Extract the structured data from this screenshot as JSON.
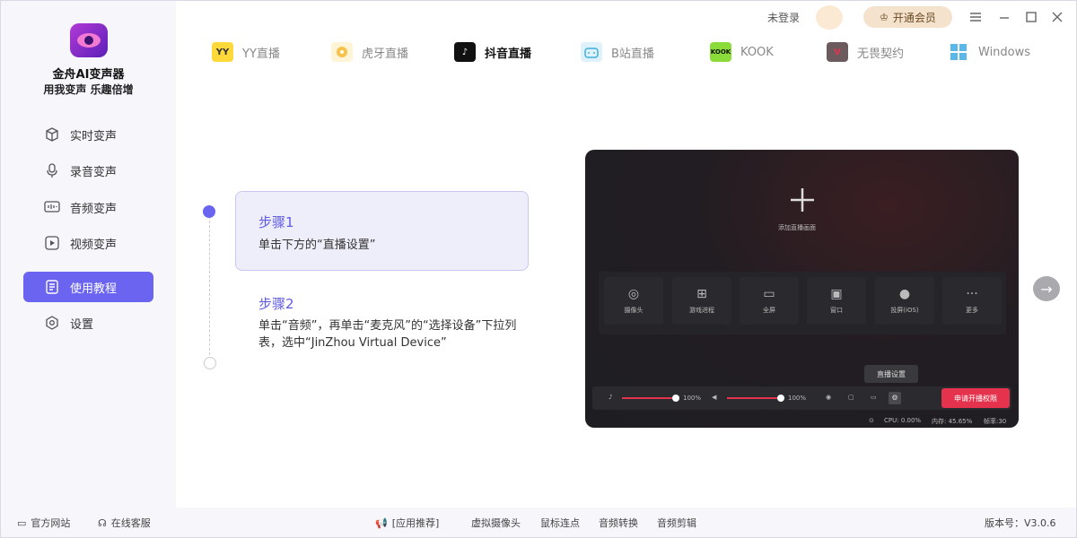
{
  "app": {
    "name": "金舟AI变声器",
    "slogan": "用我变声 乐趣倍增"
  },
  "sidebar": {
    "items": [
      {
        "label": "实时变声",
        "icon": "cube-icon"
      },
      {
        "label": "录音变声",
        "icon": "microphone-icon"
      },
      {
        "label": "音频变声",
        "icon": "audio-wave-icon"
      },
      {
        "label": "视频变声",
        "icon": "video-play-icon"
      },
      {
        "label": "使用教程",
        "icon": "tutorial-icon",
        "active": true
      },
      {
        "label": "设置",
        "icon": "settings-icon"
      }
    ]
  },
  "header": {
    "login": "未登录",
    "vip": "开通会员"
  },
  "tabs": [
    {
      "label": "YY直播",
      "icon_text": "YY"
    },
    {
      "label": "虎牙直播",
      "icon_text": ""
    },
    {
      "label": "抖音直播",
      "icon_text": "",
      "active": true
    },
    {
      "label": "B站直播",
      "icon_text": ""
    },
    {
      "label": "KOOK",
      "icon_text": "KOOK"
    },
    {
      "label": "无畏契约",
      "icon_text": "V"
    },
    {
      "label": "Windows",
      "icon_text": ""
    }
  ],
  "steps": [
    {
      "title": "步骤1",
      "desc": "单击下方的“直播设置”"
    },
    {
      "title": "步骤2",
      "desc": "单击“音频”，再单击“麦克风”的“选择设备”下拉列表，选中“JinZhou Virtual Device”"
    }
  ],
  "preview": {
    "add_label": "添加直播画面",
    "sources": [
      "摄像头",
      "游戏进程",
      "全屏",
      "窗口",
      "投屏(iOS)",
      "更多"
    ],
    "mic_volume": "100%",
    "speaker_volume": "100%",
    "mic_level": 1.0,
    "speaker_level": 1.0,
    "tooltip": "直播设置",
    "apply_button": "申请开播权限",
    "cpu": "CPU: 0.00%",
    "memory": "内存: 45.65%",
    "fps": "帧率:30"
  },
  "footer": {
    "website": "官方网站",
    "support": "在线客服",
    "recommend": "[应用推荐]",
    "apps": [
      "虚拟摄像头",
      "鼠标连点",
      "音频转换",
      "音频剪辑"
    ],
    "version": "版本号：V3.0.6"
  },
  "colors": {
    "accent": "#6a64f0",
    "red": "#e5334e",
    "vip": "#f5e2cc"
  }
}
